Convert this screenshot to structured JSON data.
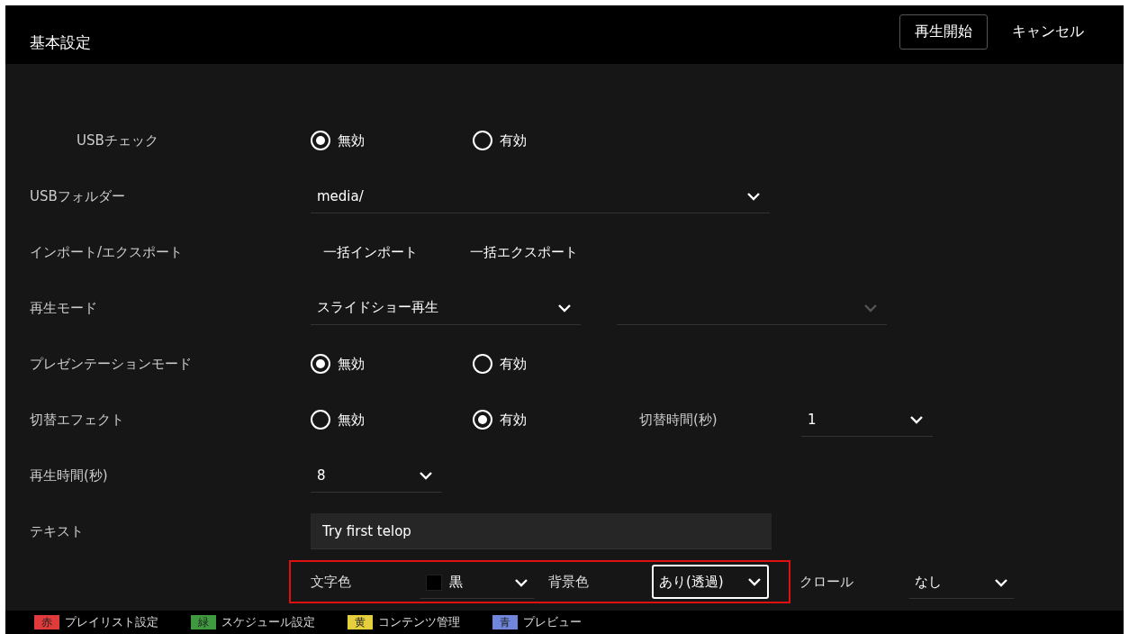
{
  "header": {
    "title": "基本設定",
    "buttons": [
      {
        "label": "再生開始",
        "kind": "outlined"
      },
      {
        "label": "キャンセル",
        "kind": "plain"
      }
    ]
  },
  "rows": [
    {
      "kind": "radio",
      "label": "USBチェック",
      "indented": true,
      "options": [
        {
          "label": "無効",
          "selected": true
        },
        {
          "label": "有効",
          "selected": false
        }
      ]
    },
    {
      "kind": "selects",
      "label": "USBフォルダー",
      "indented": false,
      "selects": [
        {
          "value": "media/",
          "kind": "wide",
          "disabled": false
        }
      ]
    },
    {
      "kind": "actions",
      "label": "インポート/エクスポート",
      "indented": false,
      "actions": [
        "一括インポート",
        "一括エクスポート"
      ]
    },
    {
      "kind": "selects",
      "label": "再生モード",
      "indented": false,
      "selects": [
        {
          "value": "スライドショー再生",
          "kind": "medium",
          "disabled": false
        },
        {
          "kind": "medium",
          "disabled": true
        }
      ]
    },
    {
      "kind": "radio",
      "label": "プレゼンテーションモード",
      "indented": false,
      "options": [
        {
          "label": "無効",
          "selected": true
        },
        {
          "label": "有効",
          "selected": false
        }
      ]
    },
    {
      "kind": "radio",
      "label": "切替エフェクト",
      "indented": false,
      "options": [
        {
          "label": "無効",
          "selected": false
        },
        {
          "label": "有効",
          "selected": true
        }
      ],
      "extra": {
        "label": "切替時間(秒)",
        "select": {
          "value": "1",
          "kind": "small",
          "disabled": false
        }
      }
    },
    {
      "kind": "selects",
      "label": "再生時間(秒)",
      "indented": false,
      "selects": [
        {
          "value": "8",
          "kind": "small",
          "disabled": false
        }
      ]
    },
    {
      "kind": "text",
      "label": "テキスト",
      "indented": false,
      "value": "Try first telop"
    },
    {
      "kind": "style",
      "fields": [
        {
          "label": "文字色",
          "value": "黒",
          "color": "#000000",
          "focused": false,
          "highlighted": true
        },
        {
          "label": "背景色",
          "value": "あり(透過)",
          "focused": true,
          "highlighted": true
        },
        {
          "label": "クロール",
          "value": "なし",
          "focused": false,
          "highlighted": false
        }
      ]
    }
  ],
  "footer": [
    {
      "key": "赤",
      "label": "プレイリスト設定",
      "color": "#e03a3a"
    },
    {
      "key": "緑",
      "label": "スケジュール設定",
      "color": "#3f9a3f"
    },
    {
      "key": "黄",
      "label": "コンテンツ管理",
      "color": "#e6cf3c"
    },
    {
      "key": "青",
      "label": "プレビュー",
      "color": "#6f86dc"
    }
  ]
}
